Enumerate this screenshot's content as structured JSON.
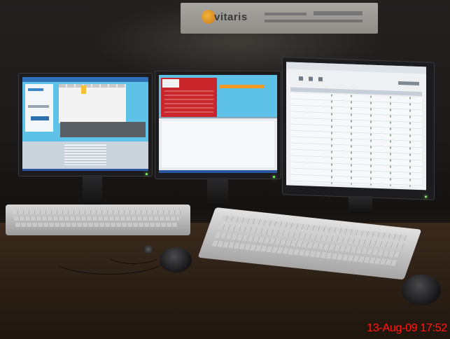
{
  "photo": {
    "timestamp": "13-Aug-09 17:52",
    "poster_brand": "vitaris"
  },
  "colors": {
    "timestamp": "#ff1a12",
    "led": "#8cff6a",
    "left_screen": "#5ec2e8",
    "center_screen_panel": "#c8262a",
    "right_screen": "#eef0f1"
  }
}
